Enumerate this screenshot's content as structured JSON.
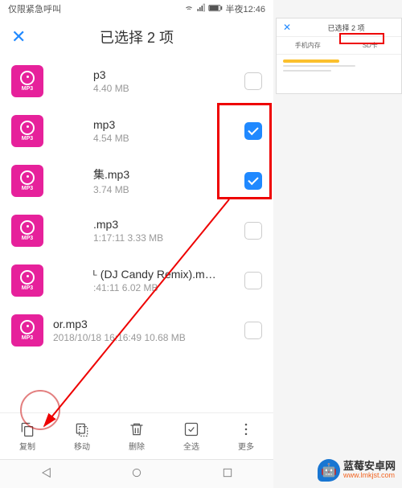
{
  "statusBar": {
    "left": "仅限紧急呼叫",
    "timeLabel": "半夜12:46"
  },
  "header": {
    "closeGlyph": "✕",
    "title": "已选择 2 项"
  },
  "files": [
    {
      "name": "p3",
      "meta": "4.40 MB",
      "checked": false
    },
    {
      "name": "mp3",
      "meta": "4.54 MB",
      "checked": true
    },
    {
      "name": "集.mp3",
      "meta": "3.74 MB",
      "checked": true
    },
    {
      "name": ".mp3",
      "meta": "1:17:11 3.33 MB",
      "checked": false
    },
    {
      "name": "ᴸ (DJ Candy Remix).m…",
      "meta": ":41:11 6.02 MB",
      "checked": false
    },
    {
      "name": "or.mp3",
      "meta": "2018/10/18 16:16:49 10.68 MB",
      "checked": false
    }
  ],
  "iconLabel": "MP3",
  "toolbar": {
    "copy": "复制",
    "move": "移动",
    "delete": "删除",
    "selectAll": "全选",
    "more": "更多"
  },
  "preview": {
    "closeGlyph": "✕",
    "title": "已选择 2 项",
    "tab1": "手机内存",
    "tab2": "SD卡",
    "chevron": "›"
  },
  "watermark": {
    "emoji": "🤖",
    "title": "蓝莓安卓网",
    "url": "www.lmkjst.com"
  }
}
